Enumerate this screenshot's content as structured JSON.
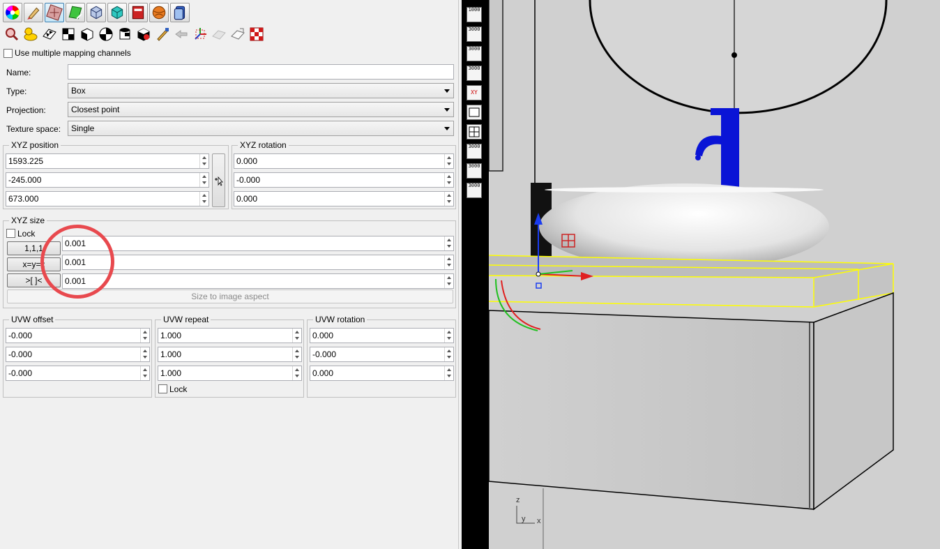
{
  "toolbar_row1": [
    {
      "icon": "color-wheel-icon",
      "active": false
    },
    {
      "icon": "paint-brush-icon",
      "active": false
    },
    {
      "icon": "texture-mapping-icon",
      "active": true
    },
    {
      "icon": "green-decal-icon",
      "active": false
    },
    {
      "icon": "cube-wire-icon",
      "active": false
    },
    {
      "icon": "cyan-cube-icon",
      "active": false
    },
    {
      "icon": "red-book-icon",
      "active": false
    },
    {
      "icon": "orange-ball-icon",
      "active": false
    },
    {
      "icon": "layers-stack-icon",
      "active": false
    }
  ],
  "toolbar_row2": [
    {
      "icon": "magnify-mapping-icon"
    },
    {
      "icon": "yellow-duck-icon"
    },
    {
      "icon": "checker-planar-icon"
    },
    {
      "icon": "checker-box-icon"
    },
    {
      "icon": "checker-cube-icon"
    },
    {
      "icon": "checker-sphere-icon"
    },
    {
      "icon": "checker-cylinder-icon"
    },
    {
      "icon": "checker-red-icon"
    },
    {
      "icon": "brush-apply-icon"
    },
    {
      "icon": "arrow-disabled-icon"
    },
    {
      "icon": "gumball-icon"
    },
    {
      "icon": "plane-disabled-icon"
    },
    {
      "icon": "plane-outline-icon"
    },
    {
      "icon": "red-checker-icon"
    }
  ],
  "multi_channel": {
    "label": "Use multiple mapping channels",
    "checked": false
  },
  "name_field": {
    "label": "Name:",
    "value": ""
  },
  "type_field": {
    "label": "Type:",
    "value": "Box"
  },
  "projection_field": {
    "label": "Projection:",
    "value": "Closest point"
  },
  "texture_space_field": {
    "label": "Texture space:",
    "value": "Single"
  },
  "xyz_position": {
    "title": "XYZ position",
    "x": "1593.225",
    "y": "-245.000",
    "z": "673.000"
  },
  "xyz_rotation": {
    "title": "XYZ rotation",
    "x": "0.000",
    "y": "-0.000",
    "z": "0.000"
  },
  "xyz_size": {
    "title": "XYZ size",
    "lock_label": "Lock",
    "btn_111": "1,1,1",
    "btn_xyz": "x=y=z",
    "btn_fit": ">[ ]<",
    "x": "0.001",
    "y": "0.001",
    "z": "0.001",
    "aspect_button": "Size to image aspect"
  },
  "uvw_offset": {
    "title": "UVW offset",
    "u": "-0.000",
    "v": "-0.000",
    "w": "-0.000"
  },
  "uvw_repeat": {
    "title": "UVW repeat",
    "u": "1.000",
    "v": "1.000",
    "w": "1.000",
    "lock_label": "Lock"
  },
  "uvw_rotation": {
    "title": "UVW rotation",
    "u": "0.000",
    "v": "-0.000",
    "w": "0.000"
  },
  "sidebar_buttons": [
    {
      "icon": "layout-1000-icon",
      "text": "1000"
    },
    {
      "icon": "layout-3000-icon",
      "text": "3000"
    },
    {
      "icon": "layout-3000-red-icon",
      "text": "3000"
    },
    {
      "icon": "layout-3000-b-icon",
      "text": "3000"
    },
    {
      "icon": "xy-plane-icon",
      "text": "XY"
    },
    {
      "icon": "single-viewport-icon",
      "text": ""
    },
    {
      "icon": "four-viewports-icon",
      "text": ""
    },
    {
      "icon": "layout-3000-c-icon",
      "text": "3000"
    },
    {
      "icon": "layout-3000-d-icon",
      "text": "3000"
    },
    {
      "icon": "layout-3000-e-icon",
      "text": "3000"
    }
  ],
  "viewport_axis": {
    "z": "z",
    "y": "y",
    "x": "x"
  },
  "colors": {
    "accent_yellow": "#ffff00",
    "faucet_blue": "#0a14d6",
    "annotation_red": "#e8494e"
  }
}
